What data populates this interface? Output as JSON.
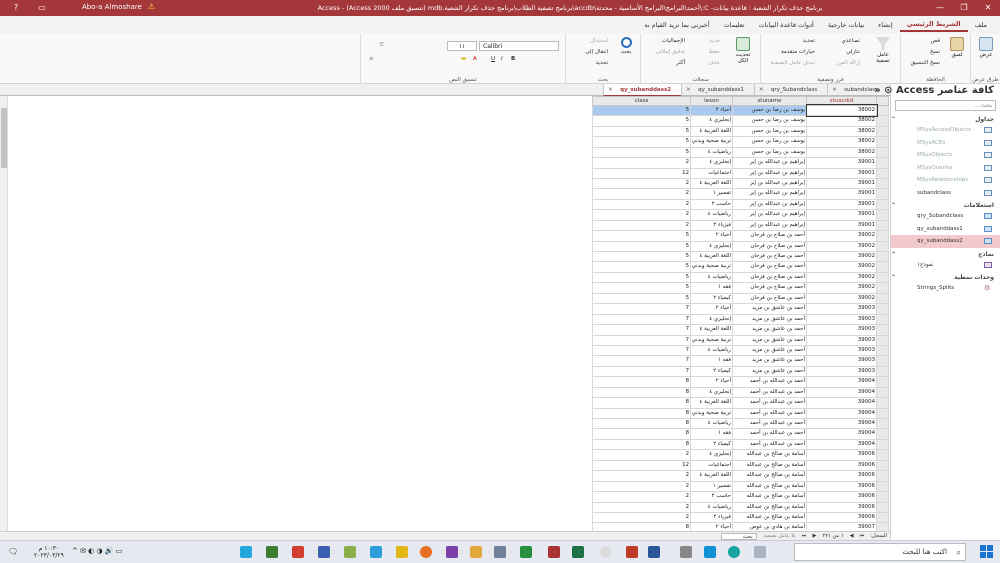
{
  "titlebar": {
    "title": "برنامج حذف تكرار الشعبة : قاعدة بيانات- C:\\أحمد\\البرامج\\البرامج الأساسية - محدثة\\accdb\\برنامج تصفية الطلاب\\برنامج حذف تكرار الشعبة.mdb (تنسيق ملف Access 2000) - Access",
    "user": "Abo-a Almoshare",
    "warning": "⚠"
  },
  "ribbon_tabs": [
    "ملف",
    "الشريط الرئيسي",
    "إنشاء",
    "بيانات خارجية",
    "أدوات قاعدة البيانات",
    "تعليمات",
    "أخبرني بما تريد القيام به"
  ],
  "ribbon": {
    "views": {
      "label": "طرق عرض",
      "btn": "عرض"
    },
    "clipboard": {
      "label": "الحافظة",
      "paste": "لصق",
      "cut": "قص",
      "copy": "نسخ",
      "format_painter": "نسخ التنسيق"
    },
    "sort_filter": {
      "label": "فرز وتصفية",
      "filter": "عامل تصفية",
      "ascending": "تصاعدي",
      "descending": "تنازلي",
      "remove_sort": "إزالة الفرز",
      "selection": "تحديد",
      "advanced": "خيارات متقدمة",
      "toggle_filter": "تبديل عامل التصفية"
    },
    "records": {
      "label": "سجلات",
      "refresh": "تحديث الكل",
      "new": "جديد",
      "save": "حفظ",
      "delete": "حذف",
      "totals": "الإجماليات",
      "spelling": "تدقيق إملائي",
      "more": "أكثر"
    },
    "find": {
      "label": "بحث",
      "find": "بحث",
      "replace": "استبدال",
      "goto": "انتقال إلى",
      "select": "تحديد"
    },
    "text_format": {
      "label": "تنسيق النص",
      "font": "Calibri",
      "size": "١١"
    }
  },
  "nav": {
    "title": "كافة عناصر Access",
    "search_placeholder": "بحث...",
    "sections": [
      {
        "name": "جداول",
        "items": [
          {
            "label": "MSysAccessObjects",
            "type": "table",
            "dim": true
          },
          {
            "label": "MSysACEs",
            "type": "table",
            "dim": true
          },
          {
            "label": "MSysObjects",
            "type": "table",
            "dim": true
          },
          {
            "label": "MSysQueries",
            "type": "table",
            "dim": true
          },
          {
            "label": "MSysRelationships",
            "type": "table",
            "dim": true
          },
          {
            "label": "subandclass",
            "type": "table",
            "dim": false
          }
        ]
      },
      {
        "name": "استعلامات",
        "items": [
          {
            "label": "qry_Subandclass",
            "type": "query",
            "dim": false
          },
          {
            "label": "qy_subanddass1",
            "type": "query",
            "dim": false
          },
          {
            "label": "qy_subanddass2",
            "type": "query",
            "dim": false,
            "selected": true
          }
        ]
      },
      {
        "name": "نماذج",
        "items": [
          {
            "label": "نموذج١",
            "type": "form",
            "dim": false
          }
        ]
      },
      {
        "name": "وحدات نمطية",
        "items": [
          {
            "label": "Strings_Splits",
            "type": "module",
            "dim": false
          }
        ]
      }
    ]
  },
  "doc_tabs": [
    {
      "label": "subandclass",
      "active": false
    },
    {
      "label": "qry_Subandclass",
      "active": false
    },
    {
      "label": "qy_subanddass1",
      "active": false
    },
    {
      "label": "qy_subanddass2",
      "active": true
    }
  ],
  "grid": {
    "columns": [
      "stuacdid",
      "stuname",
      "leson",
      "class"
    ],
    "rows": [
      [
        "38002",
        "يوسف بن رضا بن حسن",
        "أحياء ٢",
        "5"
      ],
      [
        "38002",
        "يوسف بن رضا بن حسن",
        "إنجليزي ٤",
        "5"
      ],
      [
        "38002",
        "يوسف بن رضا بن حسن",
        "اللغة العربية ٤",
        "5"
      ],
      [
        "38002",
        "يوسف بن رضا بن حسن",
        "تربية صحية وبدني",
        "5"
      ],
      [
        "38002",
        "يوسف بن رضا بن حسن",
        "رياضيات ٤",
        "5"
      ],
      [
        "39001",
        "إبراهيم بن عبدالله بن إبر",
        "إنجليزي ٤",
        "2"
      ],
      [
        "39001",
        "إبراهيم بن عبدالله بن إبر",
        "اجتماعيات",
        "12"
      ],
      [
        "39001",
        "إبراهيم بن عبدالله بن إبر",
        "اللغة العربية ٤",
        "2"
      ],
      [
        "39001",
        "إبراهيم بن عبدالله بن إبر",
        "تفسير ١",
        "2"
      ],
      [
        "39001",
        "إبراهيم بن عبدالله بن إبر",
        "حاسب ٢",
        "2"
      ],
      [
        "39001",
        "إبراهيم بن عبدالله بن إبر",
        "رياضيات ٤",
        "2"
      ],
      [
        "39001",
        "إبراهيم بن عبدالله بن إبر",
        "فيزياء ٢",
        "2"
      ],
      [
        "39002",
        "أحمد بن صلاح بن فرحان",
        "أحياء ٢",
        "5"
      ],
      [
        "39002",
        "أحمد بن صلاح بن فرحان",
        "إنجليزي ٤",
        "5"
      ],
      [
        "39002",
        "أحمد بن صلاح بن فرحان",
        "اللغة العربية ٤",
        "5"
      ],
      [
        "39002",
        "أحمد بن صلاح بن فرحان",
        "تربية صحية وبدني",
        "5"
      ],
      [
        "39002",
        "أحمد بن صلاح بن فرحان",
        "رياضيات ٤",
        "5"
      ],
      [
        "39002",
        "أحمد بن صلاح بن فرحان",
        "فقه ١",
        "5"
      ],
      [
        "39002",
        "أحمد بن صلاح بن فرحان",
        "كيمياء ٢",
        "5"
      ],
      [
        "39003",
        "أحمد بن عاشق بن مزيد",
        "أحياء ٢",
        "7"
      ],
      [
        "39003",
        "أحمد بن عاشق بن مزيد",
        "إنجليزي ٤",
        "7"
      ],
      [
        "39003",
        "أحمد بن عاشق بن مزيد",
        "اللغة العربية ٤",
        "7"
      ],
      [
        "39003",
        "أحمد بن عاشق بن مزيد",
        "تربية صحية وبدني",
        "7"
      ],
      [
        "39003",
        "أحمد بن عاشق بن مزيد",
        "رياضيات ٤",
        "7"
      ],
      [
        "39003",
        "أحمد بن عاشق بن مزيد",
        "فقه ١",
        "7"
      ],
      [
        "39003",
        "أحمد بن عاشق بن مزيد",
        "كيمياء ٢",
        "7"
      ],
      [
        "39004",
        "أحمد بن عبدالله بن أحمد",
        "أحياء ٢",
        "8"
      ],
      [
        "39004",
        "أحمد بن عبدالله بن أحمد",
        "إنجليزي ٤",
        "8"
      ],
      [
        "39004",
        "أحمد بن عبدالله بن أحمد",
        "اللغة العربية ٤",
        "8"
      ],
      [
        "39004",
        "أحمد بن عبدالله بن أحمد",
        "تربية صحية وبدني",
        "8"
      ],
      [
        "39004",
        "أحمد بن عبدالله بن أحمد",
        "رياضيات ٤",
        "8"
      ],
      [
        "39004",
        "أحمد بن عبدالله بن أحمد",
        "فقه ١",
        "8"
      ],
      [
        "39004",
        "أحمد بن عبدالله بن أحمد",
        "كيمياء ٢",
        "8"
      ],
      [
        "39006",
        "أسامة بن صالح بن عبدالله",
        "إنجليزي ٤",
        "2"
      ],
      [
        "39006",
        "أسامة بن صالح بن عبدالله",
        "اجتماعيات",
        "12"
      ],
      [
        "39006",
        "أسامة بن صالح بن عبدالله",
        "اللغة العربية ٤",
        "2"
      ],
      [
        "39006",
        "أسامة بن صالح بن عبدالله",
        "تفسير ١",
        "2"
      ],
      [
        "39006",
        "أسامة بن صالح بن عبدالله",
        "حاسب ٢",
        "2"
      ],
      [
        "39006",
        "أسامة بن صالح بن عبدالله",
        "رياضيات ٤",
        "2"
      ],
      [
        "39006",
        "أسامة بن صالح بن عبدالله",
        "فيزياء ٢",
        "2"
      ],
      [
        "39007",
        "أسامة بن هادي بن عوض",
        "أحياء ٢",
        "8"
      ]
    ]
  },
  "recnav": {
    "label": "السجل:",
    "position": "١ من ٢٧١",
    "filter": "بلا عامل تصفية",
    "search": "بحث"
  },
  "taskbar": {
    "search": "اكتب هنا للبحث",
    "time": "١٠:٣٠ م",
    "date": "٢٠٢٣/٠٣/٢٩"
  }
}
